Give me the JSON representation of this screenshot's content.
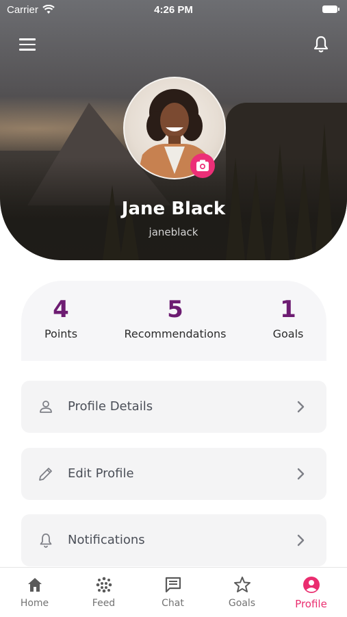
{
  "status_bar": {
    "carrier": "Carrier",
    "time": "4:26 PM"
  },
  "profile": {
    "name": "Jane Black",
    "username": "janeblack"
  },
  "stats": [
    {
      "value": "4",
      "label": "Points"
    },
    {
      "value": "5",
      "label": "Recommendations"
    },
    {
      "value": "1",
      "label": "Goals"
    }
  ],
  "menu": [
    {
      "label": "Profile Details",
      "icon": "person-icon"
    },
    {
      "label": "Edit Profile",
      "icon": "pencil-icon"
    },
    {
      "label": "Notifications",
      "icon": "bell-icon"
    }
  ],
  "tabs": [
    {
      "label": "Home",
      "icon": "home-icon"
    },
    {
      "label": "Feed",
      "icon": "feed-icon"
    },
    {
      "label": "Chat",
      "icon": "chat-icon"
    },
    {
      "label": "Goals",
      "icon": "star-icon"
    },
    {
      "label": "Profile",
      "icon": "profile-icon",
      "active": true
    }
  ],
  "colors": {
    "accent": "#ea2d6f",
    "stat_number": "#6d1c72",
    "card_bg": "#f4f4f5"
  }
}
